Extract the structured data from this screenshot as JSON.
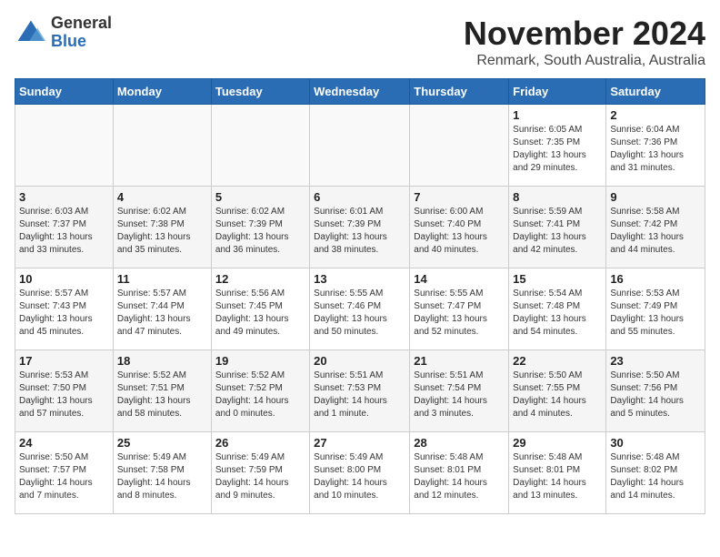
{
  "logo": {
    "general": "General",
    "blue": "Blue"
  },
  "title": "November 2024",
  "subtitle": "Renmark, South Australia, Australia",
  "headers": [
    "Sunday",
    "Monday",
    "Tuesday",
    "Wednesday",
    "Thursday",
    "Friday",
    "Saturday"
  ],
  "weeks": [
    [
      {
        "day": "",
        "info": ""
      },
      {
        "day": "",
        "info": ""
      },
      {
        "day": "",
        "info": ""
      },
      {
        "day": "",
        "info": ""
      },
      {
        "day": "",
        "info": ""
      },
      {
        "day": "1",
        "info": "Sunrise: 6:05 AM\nSunset: 7:35 PM\nDaylight: 13 hours\nand 29 minutes."
      },
      {
        "day": "2",
        "info": "Sunrise: 6:04 AM\nSunset: 7:36 PM\nDaylight: 13 hours\nand 31 minutes."
      }
    ],
    [
      {
        "day": "3",
        "info": "Sunrise: 6:03 AM\nSunset: 7:37 PM\nDaylight: 13 hours\nand 33 minutes."
      },
      {
        "day": "4",
        "info": "Sunrise: 6:02 AM\nSunset: 7:38 PM\nDaylight: 13 hours\nand 35 minutes."
      },
      {
        "day": "5",
        "info": "Sunrise: 6:02 AM\nSunset: 7:39 PM\nDaylight: 13 hours\nand 36 minutes."
      },
      {
        "day": "6",
        "info": "Sunrise: 6:01 AM\nSunset: 7:39 PM\nDaylight: 13 hours\nand 38 minutes."
      },
      {
        "day": "7",
        "info": "Sunrise: 6:00 AM\nSunset: 7:40 PM\nDaylight: 13 hours\nand 40 minutes."
      },
      {
        "day": "8",
        "info": "Sunrise: 5:59 AM\nSunset: 7:41 PM\nDaylight: 13 hours\nand 42 minutes."
      },
      {
        "day": "9",
        "info": "Sunrise: 5:58 AM\nSunset: 7:42 PM\nDaylight: 13 hours\nand 44 minutes."
      }
    ],
    [
      {
        "day": "10",
        "info": "Sunrise: 5:57 AM\nSunset: 7:43 PM\nDaylight: 13 hours\nand 45 minutes."
      },
      {
        "day": "11",
        "info": "Sunrise: 5:57 AM\nSunset: 7:44 PM\nDaylight: 13 hours\nand 47 minutes."
      },
      {
        "day": "12",
        "info": "Sunrise: 5:56 AM\nSunset: 7:45 PM\nDaylight: 13 hours\nand 49 minutes."
      },
      {
        "day": "13",
        "info": "Sunrise: 5:55 AM\nSunset: 7:46 PM\nDaylight: 13 hours\nand 50 minutes."
      },
      {
        "day": "14",
        "info": "Sunrise: 5:55 AM\nSunset: 7:47 PM\nDaylight: 13 hours\nand 52 minutes."
      },
      {
        "day": "15",
        "info": "Sunrise: 5:54 AM\nSunset: 7:48 PM\nDaylight: 13 hours\nand 54 minutes."
      },
      {
        "day": "16",
        "info": "Sunrise: 5:53 AM\nSunset: 7:49 PM\nDaylight: 13 hours\nand 55 minutes."
      }
    ],
    [
      {
        "day": "17",
        "info": "Sunrise: 5:53 AM\nSunset: 7:50 PM\nDaylight: 13 hours\nand 57 minutes."
      },
      {
        "day": "18",
        "info": "Sunrise: 5:52 AM\nSunset: 7:51 PM\nDaylight: 13 hours\nand 58 minutes."
      },
      {
        "day": "19",
        "info": "Sunrise: 5:52 AM\nSunset: 7:52 PM\nDaylight: 14 hours\nand 0 minutes."
      },
      {
        "day": "20",
        "info": "Sunrise: 5:51 AM\nSunset: 7:53 PM\nDaylight: 14 hours\nand 1 minute."
      },
      {
        "day": "21",
        "info": "Sunrise: 5:51 AM\nSunset: 7:54 PM\nDaylight: 14 hours\nand 3 minutes."
      },
      {
        "day": "22",
        "info": "Sunrise: 5:50 AM\nSunset: 7:55 PM\nDaylight: 14 hours\nand 4 minutes."
      },
      {
        "day": "23",
        "info": "Sunrise: 5:50 AM\nSunset: 7:56 PM\nDaylight: 14 hours\nand 5 minutes."
      }
    ],
    [
      {
        "day": "24",
        "info": "Sunrise: 5:50 AM\nSunset: 7:57 PM\nDaylight: 14 hours\nand 7 minutes."
      },
      {
        "day": "25",
        "info": "Sunrise: 5:49 AM\nSunset: 7:58 PM\nDaylight: 14 hours\nand 8 minutes."
      },
      {
        "day": "26",
        "info": "Sunrise: 5:49 AM\nSunset: 7:59 PM\nDaylight: 14 hours\nand 9 minutes."
      },
      {
        "day": "27",
        "info": "Sunrise: 5:49 AM\nSunset: 8:00 PM\nDaylight: 14 hours\nand 10 minutes."
      },
      {
        "day": "28",
        "info": "Sunrise: 5:48 AM\nSunset: 8:01 PM\nDaylight: 14 hours\nand 12 minutes."
      },
      {
        "day": "29",
        "info": "Sunrise: 5:48 AM\nSunset: 8:01 PM\nDaylight: 14 hours\nand 13 minutes."
      },
      {
        "day": "30",
        "info": "Sunrise: 5:48 AM\nSunset: 8:02 PM\nDaylight: 14 hours\nand 14 minutes."
      }
    ]
  ]
}
